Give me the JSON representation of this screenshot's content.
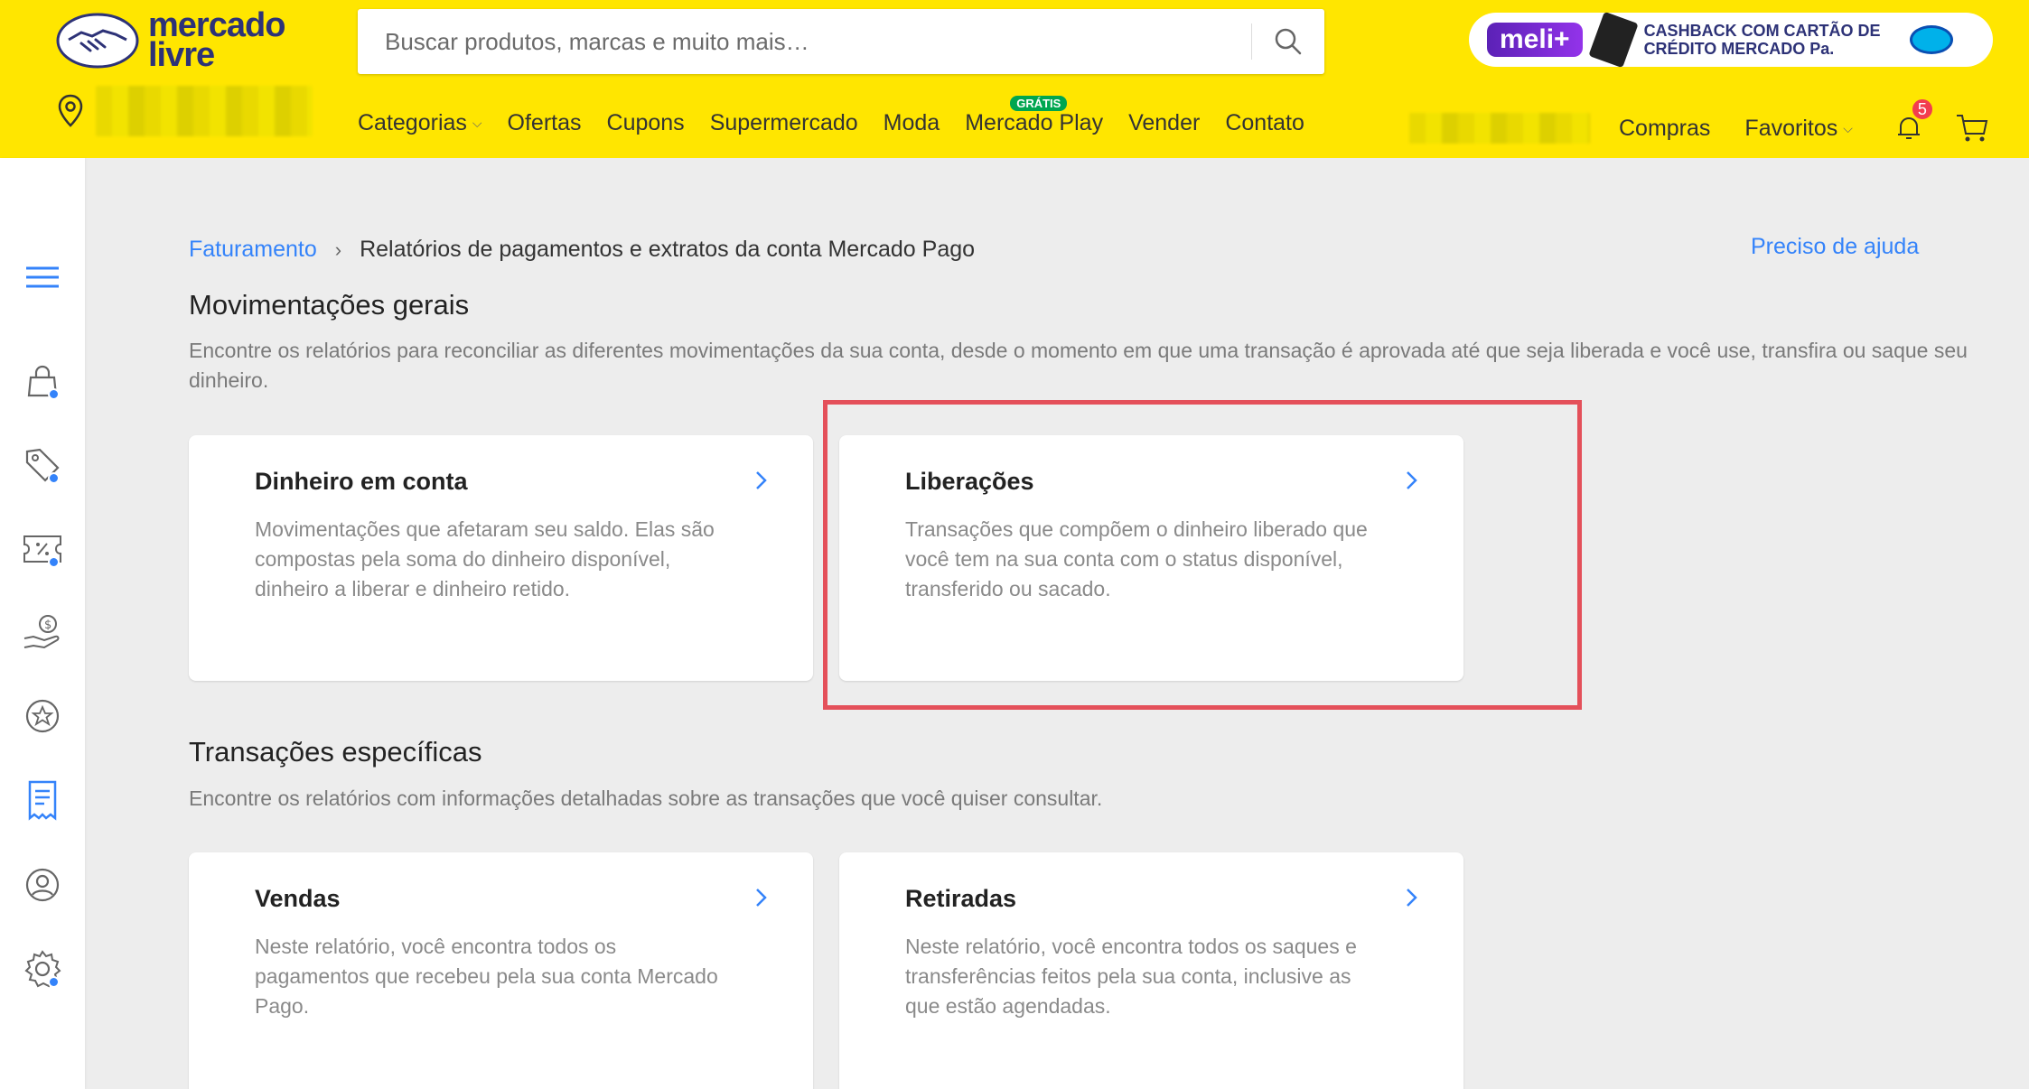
{
  "header": {
    "logo_line1": "mercado",
    "logo_line2": "livre",
    "search_placeholder": "Buscar produtos, marcas e muito mais…",
    "promo": {
      "badge": "meli+",
      "text": "CASHBACK COM CARTÃO DE CRÉDITO MERCADO Pa."
    },
    "nav": [
      {
        "label": "Categorias",
        "has_chevron": true
      },
      {
        "label": "Ofertas"
      },
      {
        "label": "Cupons"
      },
      {
        "label": "Supermercado"
      },
      {
        "label": "Moda"
      },
      {
        "label": "Mercado Play",
        "tag": "GRÁTIS"
      },
      {
        "label": "Vender"
      },
      {
        "label": "Contato"
      }
    ],
    "user": {
      "purchases": "Compras",
      "favorites": "Favoritos",
      "notifications_count": "5"
    }
  },
  "sidebar": {
    "icons": [
      "menu-icon",
      "shopping-bag-icon",
      "tag-icon",
      "ticket-percent-icon",
      "hand-money-icon",
      "star-badge-icon",
      "billing-document-icon",
      "user-icon",
      "settings-icon"
    ],
    "active": "billing-document-icon",
    "accent": "#3483fa"
  },
  "breadcrumb": {
    "parent": "Faturamento",
    "current": "Relatórios de pagamentos e extratos da conta Mercado Pago"
  },
  "help_link": "Preciso de ajuda",
  "sections": [
    {
      "title": "Movimentações gerais",
      "description": "Encontre os relatórios para reconciliar as diferentes movimentações da sua conta, desde o momento em que uma transação é aprovada até que seja liberada e você use, transfira ou saque seu dinheiro.",
      "cards": [
        {
          "title": "Dinheiro em conta",
          "description": "Movimentações que afetaram seu saldo. Elas são compostas pela soma do dinheiro disponível, dinheiro a liberar e dinheiro retido."
        },
        {
          "title": "Liberações",
          "description": "Transações que compõem o dinheiro liberado que você tem na sua conta com o status disponível, transferido ou sacado."
        }
      ]
    },
    {
      "title": "Transações específicas",
      "description": "Encontre os relatórios com informações detalhadas sobre as transações que você quiser consultar.",
      "cards": [
        {
          "title": "Vendas",
          "description": "Neste relatório, você encontra todos os pagamentos que recebeu pela sua conta Mercado Pago."
        },
        {
          "title": "Retiradas",
          "description": "Neste relatório, você encontra todos os saques e transferências feitos pela sua conta, inclusive as que estão agendadas."
        }
      ]
    }
  ],
  "colors": {
    "header_bg": "#ffe600",
    "link": "#3483fa",
    "highlight_border": "#e4505a",
    "badge": "#f23d4f"
  }
}
